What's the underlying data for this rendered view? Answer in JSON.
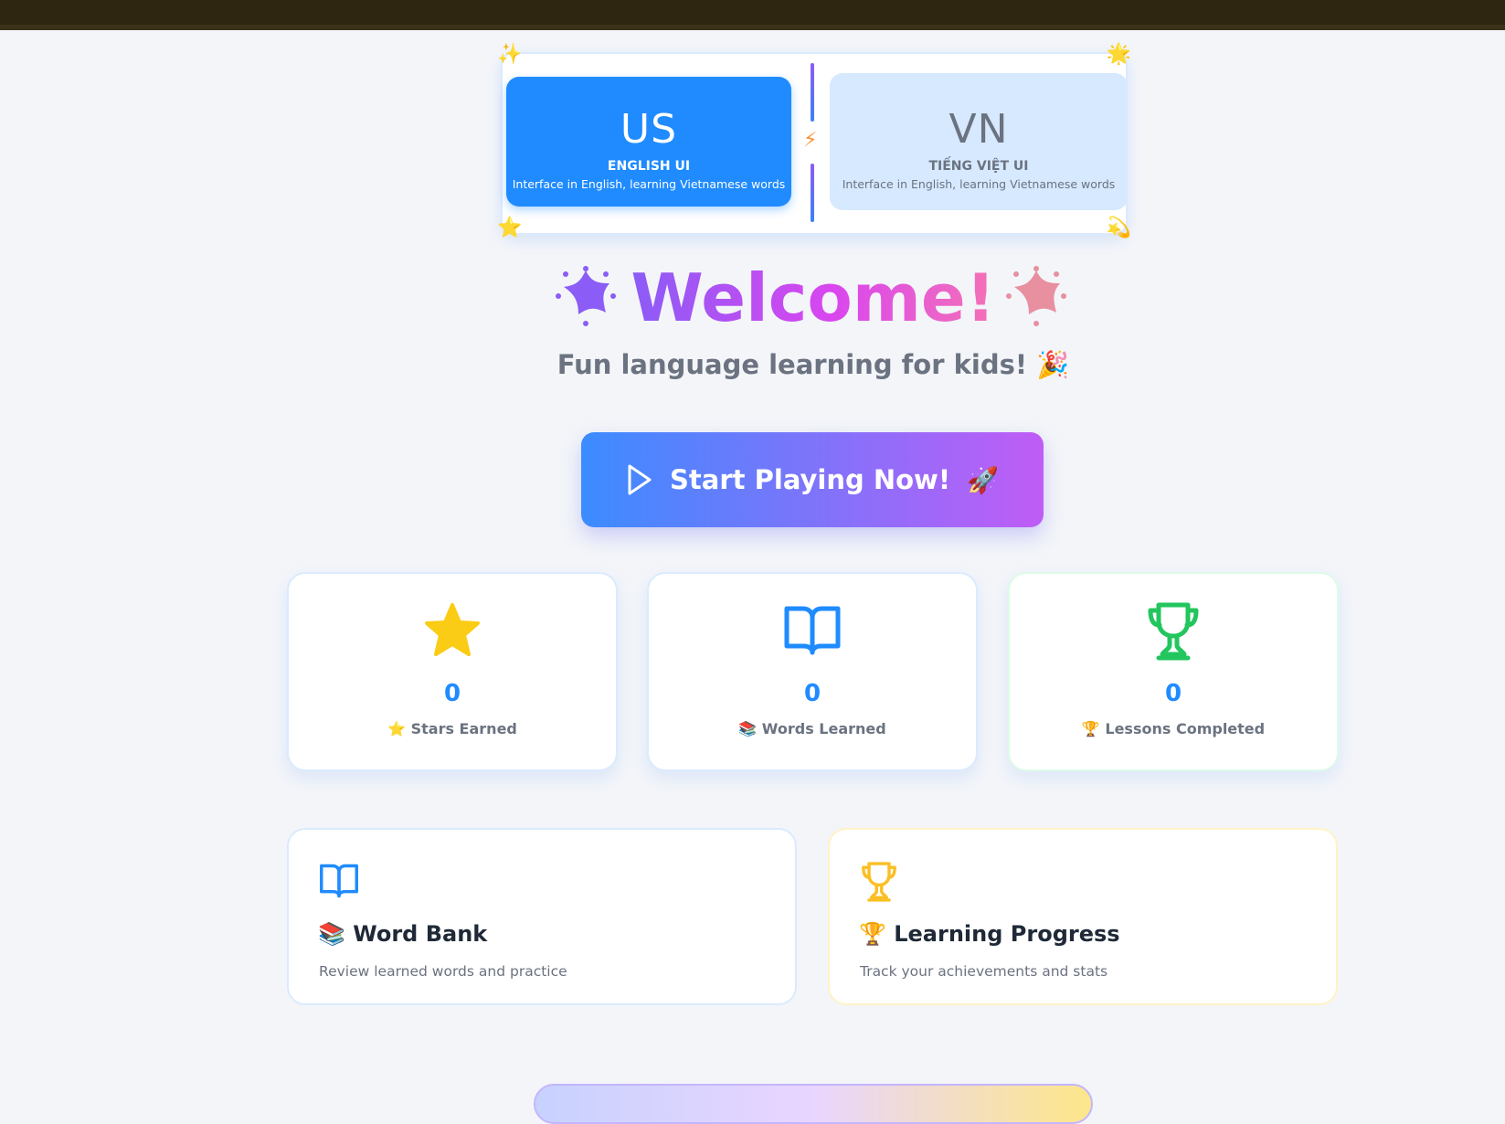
{
  "lang_switch": {
    "english": {
      "code": "US",
      "name": "ENGLISH UI",
      "desc": "Interface in English, learning Vietnamese words"
    },
    "vietnamese": {
      "code": "VN",
      "name": "TIẾNG VIỆT UI",
      "desc": "Interface in English, learning Vietnamese words"
    },
    "selected": "english"
  },
  "hero": {
    "title": "Welcome!",
    "subtitle": "Fun language learning for kids! 🎉"
  },
  "start_button": {
    "label": "Start Playing Now!",
    "emoji": "🚀"
  },
  "stats": [
    {
      "value": "0",
      "label": "⭐ Stars Earned",
      "icon": "star-icon",
      "color": "#facc15"
    },
    {
      "value": "0",
      "label": "📚 Words Learned",
      "icon": "book-icon",
      "color": "#1f8bff"
    },
    {
      "value": "0",
      "label": "🏆 Lessons Completed",
      "icon": "trophy-icon",
      "color": "#22c55e"
    }
  ],
  "features": [
    {
      "title": "📚 Word Bank",
      "desc": "Review learned words and practice",
      "icon": "book-icon",
      "color": "#1f8bff"
    },
    {
      "title": "🏆 Learning Progress",
      "desc": "Track your achievements and stats",
      "icon": "trophy-icon",
      "color": "#fbbf24"
    }
  ],
  "decor": {
    "top_left": "✨",
    "top_right": "🌟",
    "bottom_left": "⭐",
    "bottom_right": "💫",
    "center": "⚡"
  }
}
